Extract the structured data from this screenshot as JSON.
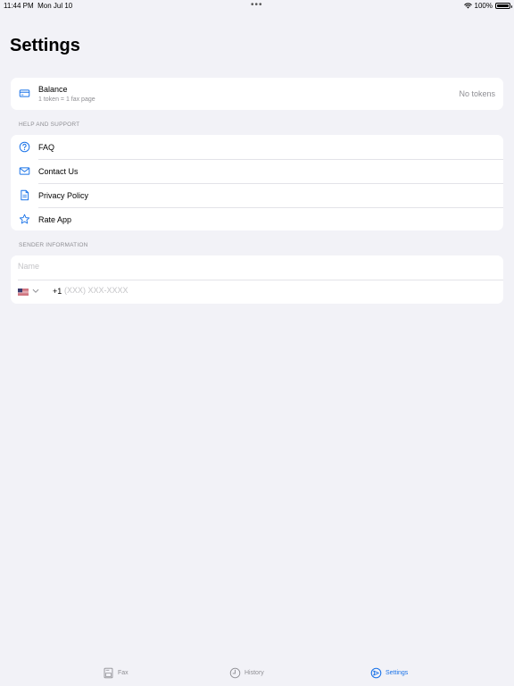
{
  "status_bar": {
    "time": "11:44 PM",
    "date": "Mon Jul 10",
    "dots": "•••",
    "battery": "100%"
  },
  "page": {
    "title": "Settings"
  },
  "balance": {
    "title": "Balance",
    "subtitle": "1 token = 1 fax page",
    "value": "No tokens",
    "icon": "credit-card-icon"
  },
  "help": {
    "header": "HELP AND SUPPORT",
    "items": [
      {
        "label": "FAQ",
        "icon": "question-circle-icon"
      },
      {
        "label": "Contact Us",
        "icon": "envelope-icon"
      },
      {
        "label": "Privacy Policy",
        "icon": "document-icon"
      },
      {
        "label": "Rate App",
        "icon": "star-icon"
      }
    ]
  },
  "sender": {
    "header": "SENDER INFORMATION",
    "name_placeholder": "Name",
    "name_value": "",
    "country_flag": "us-flag-icon",
    "phone_prefix": "+1",
    "phone_placeholder": "(XXX) XXX-XXXX",
    "phone_value": ""
  },
  "tabs": [
    {
      "label": "Fax",
      "icon": "fax-icon",
      "active": false
    },
    {
      "label": "History",
      "icon": "clock-icon",
      "active": false
    },
    {
      "label": "Settings",
      "icon": "settings-icon",
      "active": true
    }
  ],
  "colors": {
    "accent": "#1a73e8",
    "background": "#f2f2f7",
    "secondary_text": "#8e8e93"
  }
}
